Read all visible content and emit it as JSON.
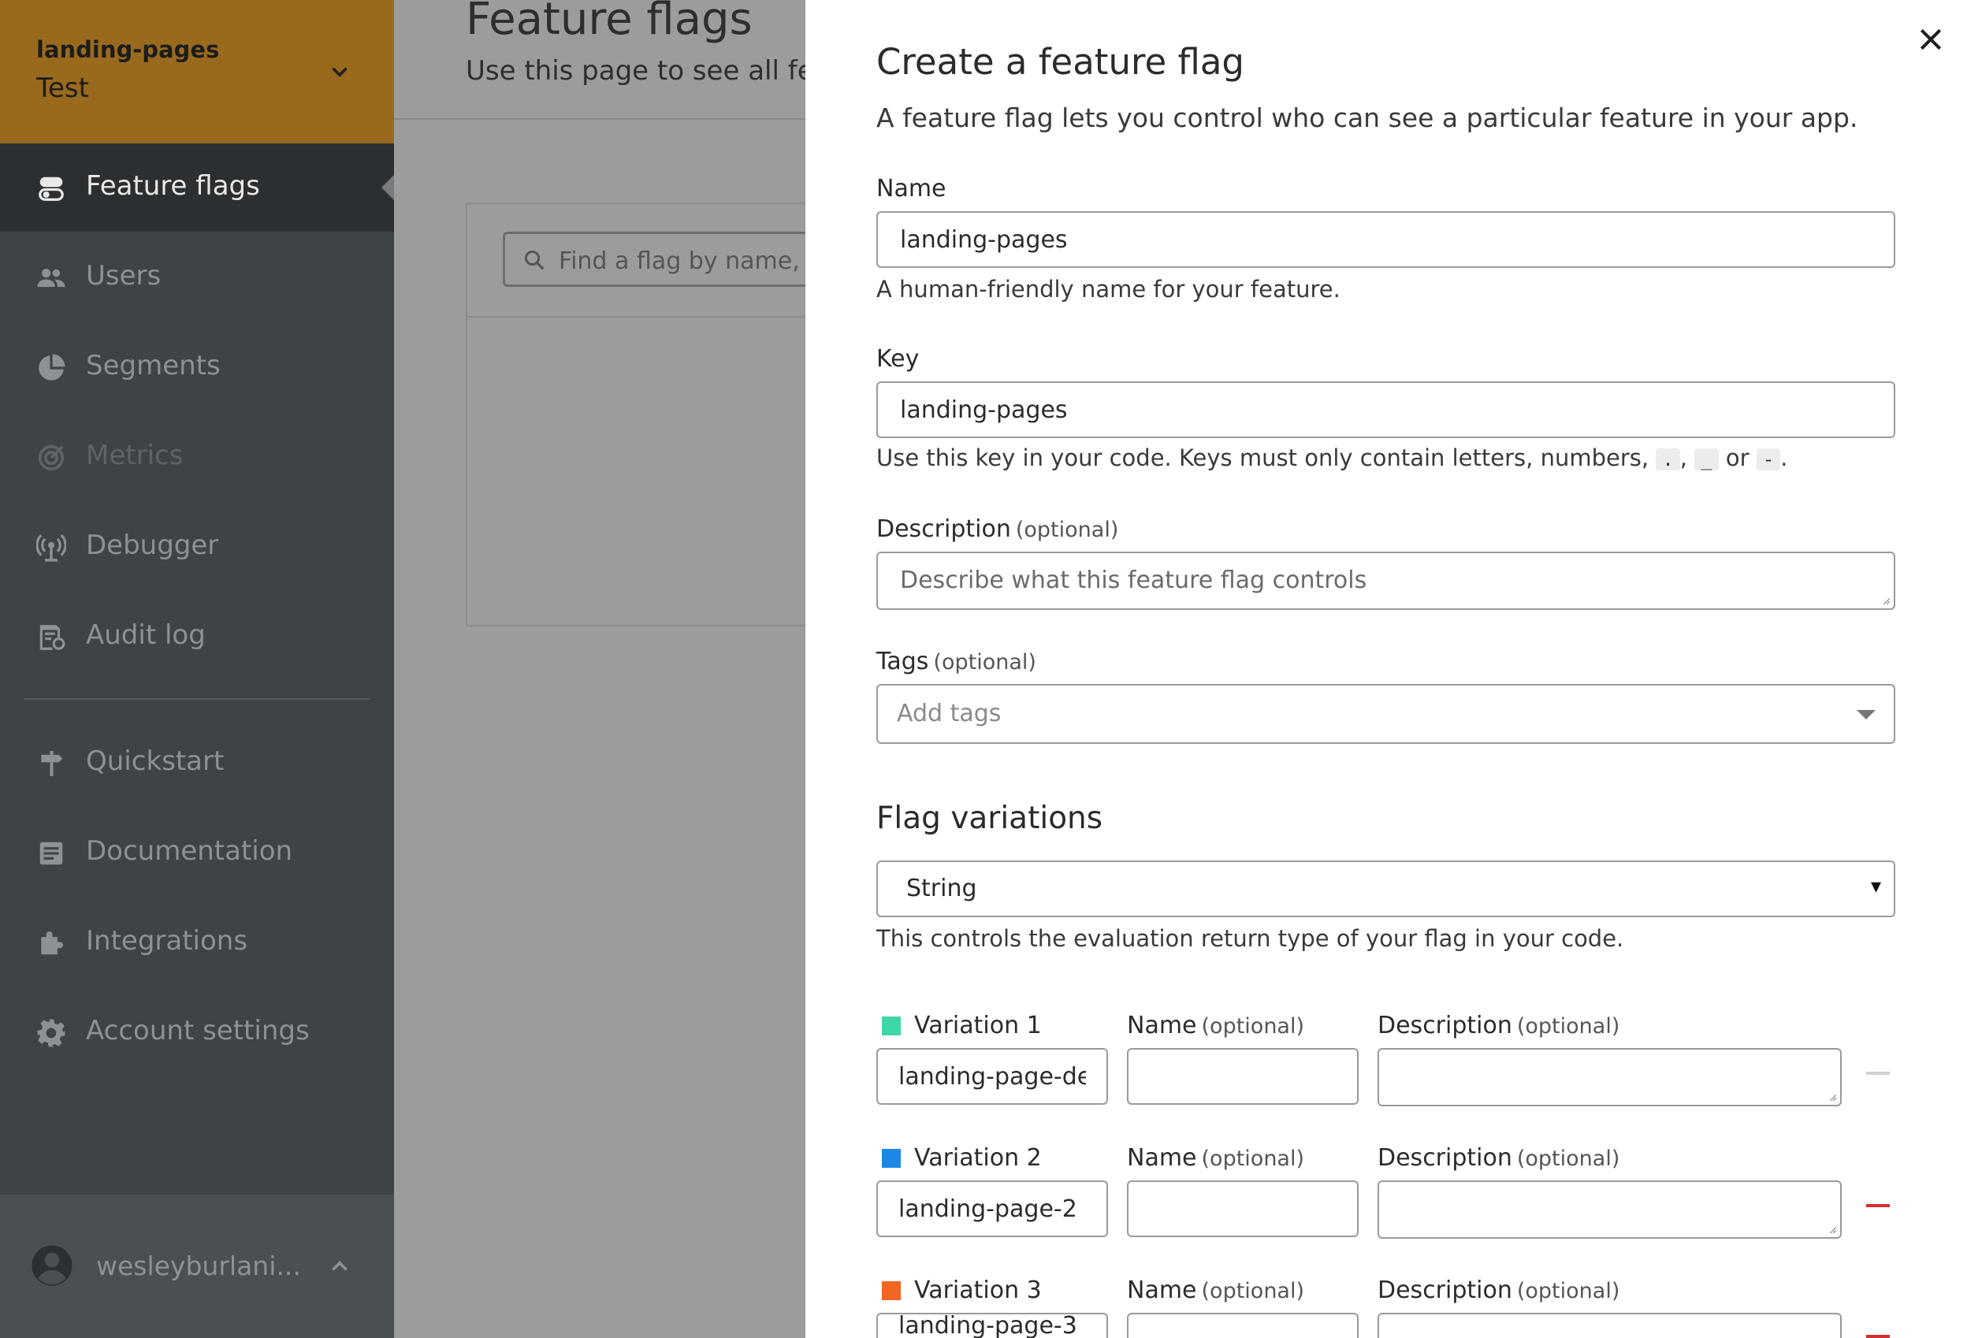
{
  "sidebar": {
    "project_name": "landing-pages",
    "environment": "Test",
    "nav": [
      {
        "label": "Feature flags",
        "icon": "toggle-icon",
        "active": true
      },
      {
        "label": "Users",
        "icon": "users-icon"
      },
      {
        "label": "Segments",
        "icon": "pie-chart-icon"
      },
      {
        "label": "Metrics",
        "icon": "target-icon",
        "disabled": true
      },
      {
        "label": "Debugger",
        "icon": "antenna-icon"
      },
      {
        "label": "Audit log",
        "icon": "audit-log-icon"
      },
      {
        "label": "Quickstart",
        "icon": "signpost-icon"
      },
      {
        "label": "Documentation",
        "icon": "document-icon"
      },
      {
        "label": "Integrations",
        "icon": "puzzle-icon"
      },
      {
        "label": "Account settings",
        "icon": "gear-icon"
      }
    ],
    "user_name": "wesleyburlani..."
  },
  "page": {
    "title": "Feature flags",
    "subtitle": "Use this page to see all featu",
    "search_placeholder": "Find a flag by name, key"
  },
  "modal": {
    "title": "Create a feature flag",
    "subtitle": "A feature flag lets you control who can see a particular feature in your app.",
    "name_label": "Name",
    "name_value": "landing-pages",
    "name_help": "A human-friendly name for your feature.",
    "key_label": "Key",
    "key_value": "landing-pages",
    "key_help_prefix": "Use this key in your code. Keys must only contain letters, numbers,",
    "key_help_chars": [
      ".",
      "_",
      "-"
    ],
    "key_help_or": "or",
    "description_label": "Description",
    "optional": "(optional)",
    "description_placeholder": "Describe what this feature flag controls",
    "tags_label": "Tags",
    "tags_placeholder": "Add tags",
    "variations_heading": "Flag variations",
    "variation_type": "String",
    "variation_type_help": "This controls the evaluation return type of your flag in your code.",
    "variation_name_label": "Name",
    "variation_description_label": "Description",
    "variations": [
      {
        "label": "Variation 1",
        "value": "landing-page-default",
        "color": "#3dd6a8"
      },
      {
        "label": "Variation 2",
        "value": "landing-page-2",
        "color": "#1e88e5"
      },
      {
        "label": "Variation 3",
        "value": "landing-page-3",
        "color": "#f26522"
      }
    ]
  },
  "colors": {
    "sidebar_bg": "#3e4346",
    "project_bg": "#996a1d",
    "remove_red": "#d32f2f"
  }
}
